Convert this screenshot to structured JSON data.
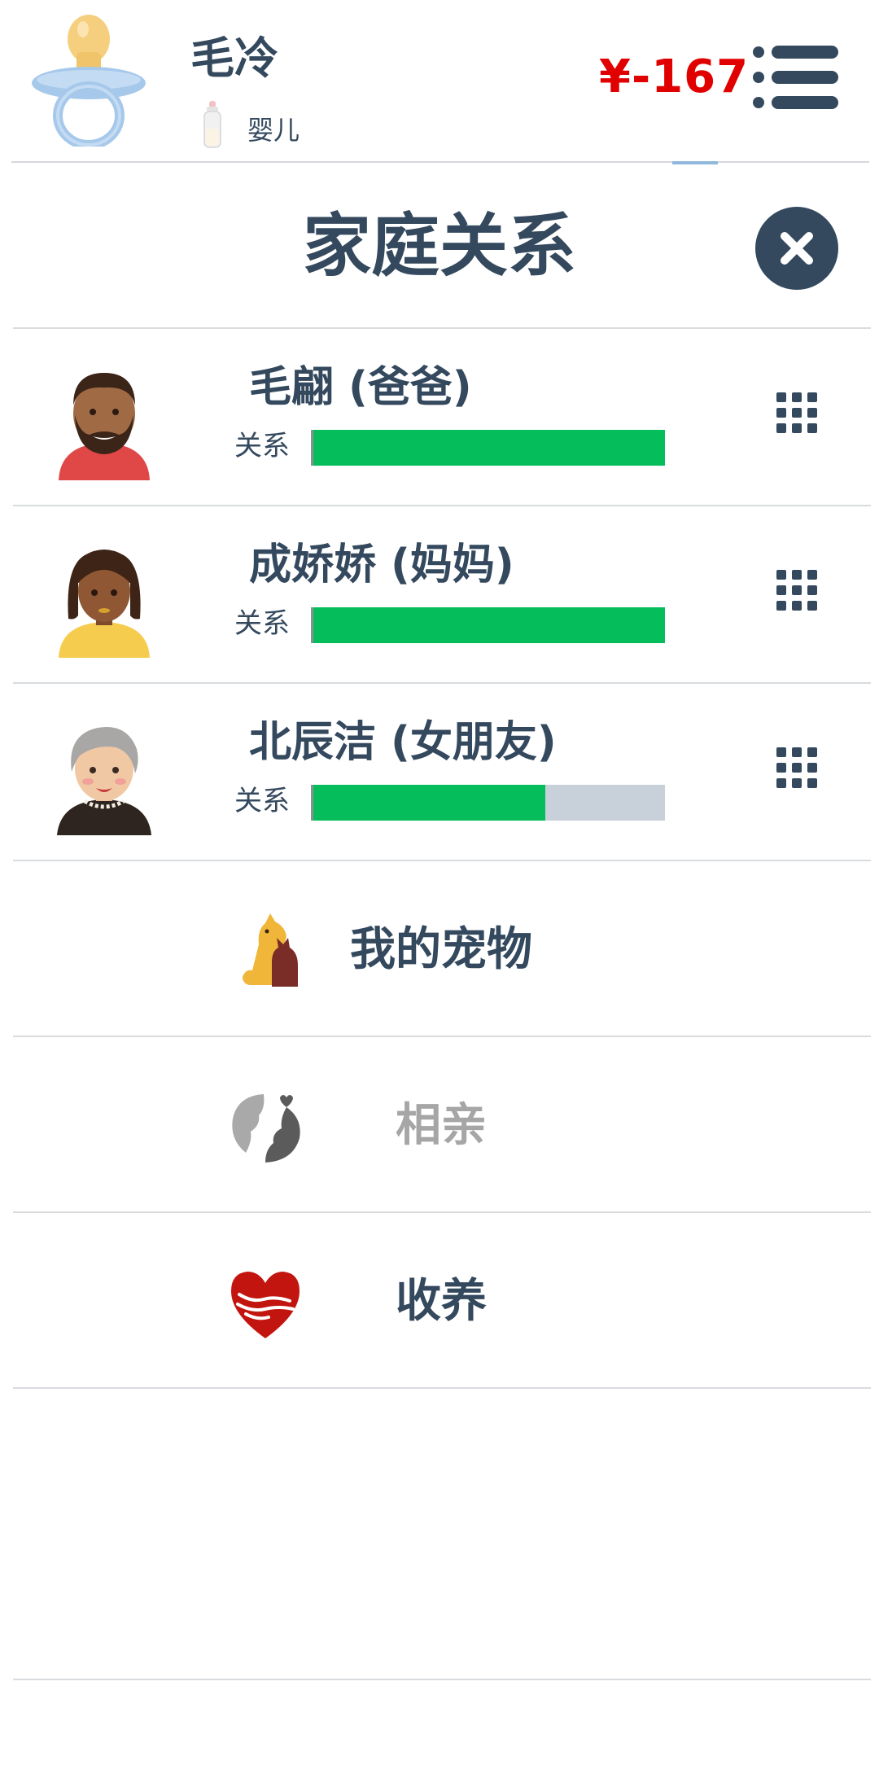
{
  "header": {
    "character_name": "毛冷",
    "life_stage": "婴儿",
    "money": "¥-167",
    "money_color": "#e00000",
    "avatar_icon": "pacifier-icon",
    "stage_icon": "baby-bottle-icon",
    "menu_icon": "list-menu-icon"
  },
  "panel": {
    "title": "家庭关系",
    "close_icon": "close-icon"
  },
  "relationships": [
    {
      "name": "毛翩 (爸爸)",
      "bar_label": "关系",
      "level": 1.0,
      "avatar_icon": "bearded-man-avatar-icon"
    },
    {
      "name": "成娇娇 (妈妈)",
      "bar_label": "关系",
      "level": 1.0,
      "avatar_icon": "woman-avatar-icon"
    },
    {
      "name": "北辰洁 (女朋友)",
      "bar_label": "关系",
      "level": 0.66,
      "avatar_icon": "elderly-woman-avatar-icon"
    }
  ],
  "actions": [
    {
      "label": "我的宠物",
      "icon": "pets-icon",
      "enabled": true
    },
    {
      "label": "相亲",
      "icon": "matchmaking-icon",
      "enabled": false
    },
    {
      "label": "收养",
      "icon": "adoption-heart-icon",
      "enabled": true
    }
  ],
  "colors": {
    "primary_text": "#34495e",
    "disabled_text": "#a6a6a6",
    "bar_fill": "#06bd5b",
    "bar_track": "#c8d1da"
  }
}
